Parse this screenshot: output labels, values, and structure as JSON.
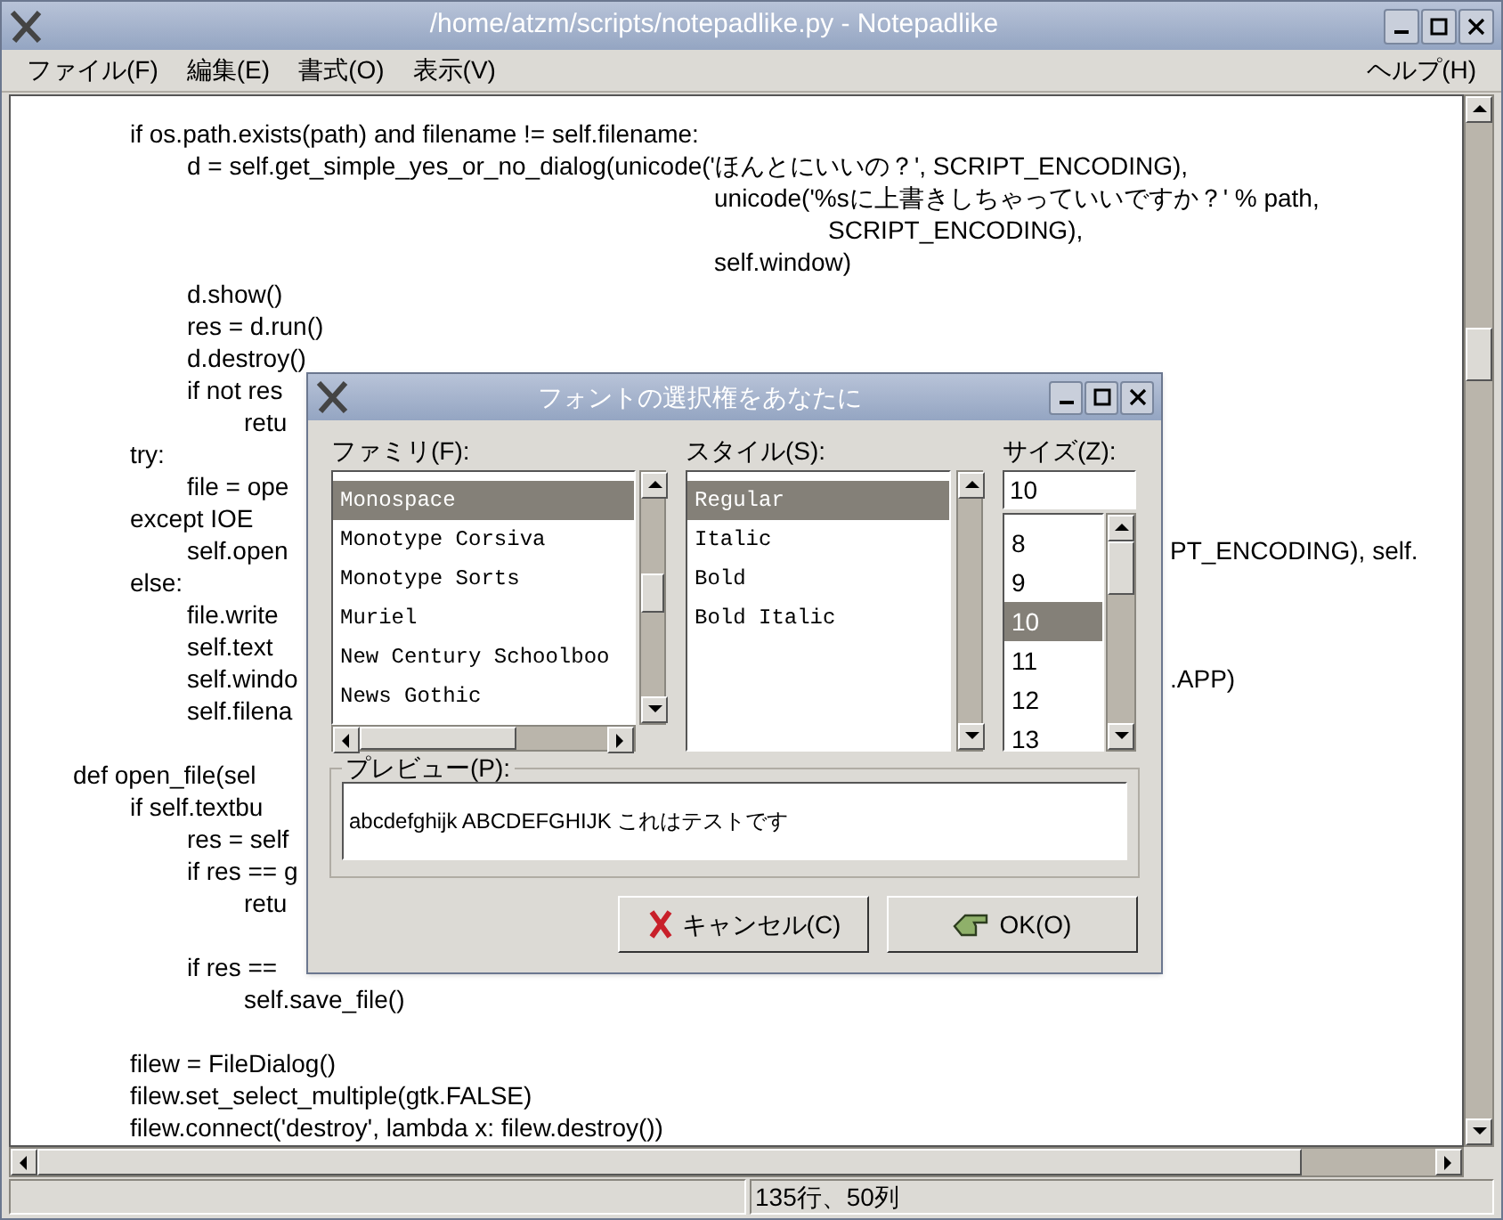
{
  "window": {
    "title": "/home/atzm/scripts/notepadlike.py - Notepadlike"
  },
  "menu": [
    {
      "label": "ファイル(F)"
    },
    {
      "label": "編集(E)"
    },
    {
      "label": "書式(O)"
    },
    {
      "label": "表示(V)"
    },
    {
      "label": "ヘルプ(H)"
    }
  ],
  "editor": {
    "blocks": [
      {
        "lines": [
          {
            "text": "        if os.path.exists(path) and filename != self.filename:"
          },
          {
            "text": "            d = self.get_simple_yes_or_no_dialog(unicode('ほんとにいいの？', SCRIPT_ENCODING),"
          },
          {
            "text": "                                                 unicode('%sに上書きしちゃっていいですか？' % path,"
          },
          {
            "text": "                                                         SCRIPT_ENCODING),"
          },
          {
            "text": "                                                 self.window)"
          },
          {
            "text": "            d.show()"
          },
          {
            "text": "            res = d.run()"
          },
          {
            "text": "            d.destroy()"
          },
          {
            "text": "            if not res"
          },
          {
            "text": "                retu"
          },
          {
            "text": "        try:"
          },
          {
            "text": "            file = ope"
          },
          {
            "text": "        except IOE"
          },
          {
            "text": "            self.open",
            "right": "PT_ENCODING), self."
          },
          {
            "text": "        else:"
          },
          {
            "text": "            file.write"
          },
          {
            "text": "            self.text"
          },
          {
            "text": "            self.windo",
            "right": ".APP)"
          },
          {
            "text": "            self.filena"
          }
        ]
      },
      {
        "lines": [
          {
            "text": "    def open_file(sel"
          },
          {
            "text": "        if self.textbu"
          },
          {
            "text": "            res = self"
          },
          {
            "text": "            if res == g"
          },
          {
            "text": "                retu"
          }
        ]
      },
      {
        "lines": [
          {
            "text": "            if res =="
          },
          {
            "text": "                self.save_file()"
          }
        ]
      },
      {
        "lines": [
          {
            "text": "        filew = FileDialog()"
          },
          {
            "text": "        filew.set_select_multiple(gtk.FALSE)"
          },
          {
            "text": "        filew.connect('destroy', lambda x: filew.destroy())"
          }
        ]
      }
    ]
  },
  "status_bar": {
    "position": "135行、50列"
  },
  "dialog": {
    "title": "フォントの選択権をあなたに",
    "family": {
      "label": "ファミリ(F):",
      "items": [
        {
          "label": "Monospace",
          "selected": true
        },
        {
          "label": "Monotype Corsiva",
          "selected": false
        },
        {
          "label": "Monotype Sorts",
          "selected": false
        },
        {
          "label": "Muriel",
          "selected": false
        },
        {
          "label": "New Century Schoolboo",
          "selected": false
        },
        {
          "label": "News Gothic",
          "selected": false
        }
      ]
    },
    "style": {
      "label": "スタイル(S):",
      "items": [
        {
          "label": "Regular",
          "selected": true
        },
        {
          "label": "Italic",
          "selected": false
        },
        {
          "label": "Bold",
          "selected": false
        },
        {
          "label": "Bold Italic",
          "selected": false
        }
      ]
    },
    "size": {
      "label": "サイズ(Z):",
      "value": "10",
      "items": [
        {
          "label": "8",
          "selected": false
        },
        {
          "label": "9",
          "selected": false
        },
        {
          "label": "10",
          "selected": true
        },
        {
          "label": "11",
          "selected": false
        },
        {
          "label": "12",
          "selected": false
        },
        {
          "label": "13",
          "selected": false
        }
      ]
    },
    "preview": {
      "label": "プレビュー(P):",
      "text": "abcdefghijk ABCDEFGHIJK これはテストです"
    },
    "buttons": [
      {
        "label": "キャンセル(C)",
        "kind": "cancel"
      },
      {
        "label": "OK(O)",
        "kind": "ok"
      }
    ]
  }
}
